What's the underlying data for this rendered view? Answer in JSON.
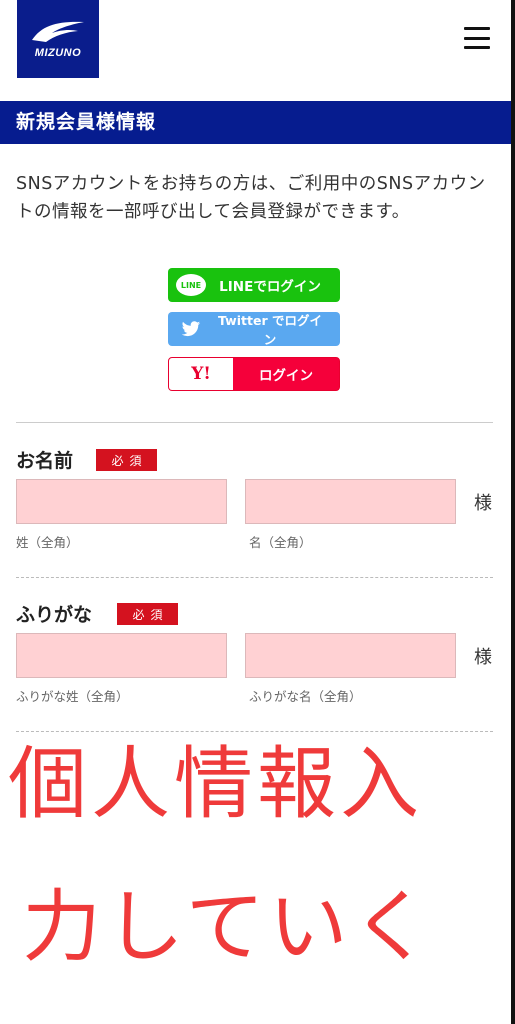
{
  "header": {
    "logo_text": "MIZUNO",
    "menu_icon": "hamburger-icon"
  },
  "page": {
    "title": "新規会員様情報",
    "intro": "SNSアカウントをお持ちの方は、ご利用中のSNSアカウントの情報を一部呼び出して会員登録ができます。"
  },
  "sns": {
    "line_icon_text": "LINE",
    "line_label": "LINEでログイン",
    "twitter_label": "Twitter でログイン",
    "yahoo_icon_text": "Y!",
    "yahoo_label": "ログイン"
  },
  "form": {
    "name": {
      "label": "お名前",
      "required": "必須",
      "last_hint": "姓（全角）",
      "first_hint": "名（全角）",
      "suffix": "様"
    },
    "furigana": {
      "label": "ふりがな",
      "required": "必須",
      "last_hint": "ふりがな姓（全角）",
      "first_hint": "ふりがな名（全角）",
      "suffix": "様"
    }
  },
  "overlay": {
    "line1": "個人情報入",
    "line2": "力していく"
  },
  "colors": {
    "brand_navy": "#061c8f",
    "line_green": "#19c20e",
    "twitter_blue": "#5aa8f0",
    "yahoo_red": "#f5003a",
    "required_red": "#d4121f",
    "input_pink": "#ffd1d3",
    "overlay_red": "#ef3a3a"
  }
}
